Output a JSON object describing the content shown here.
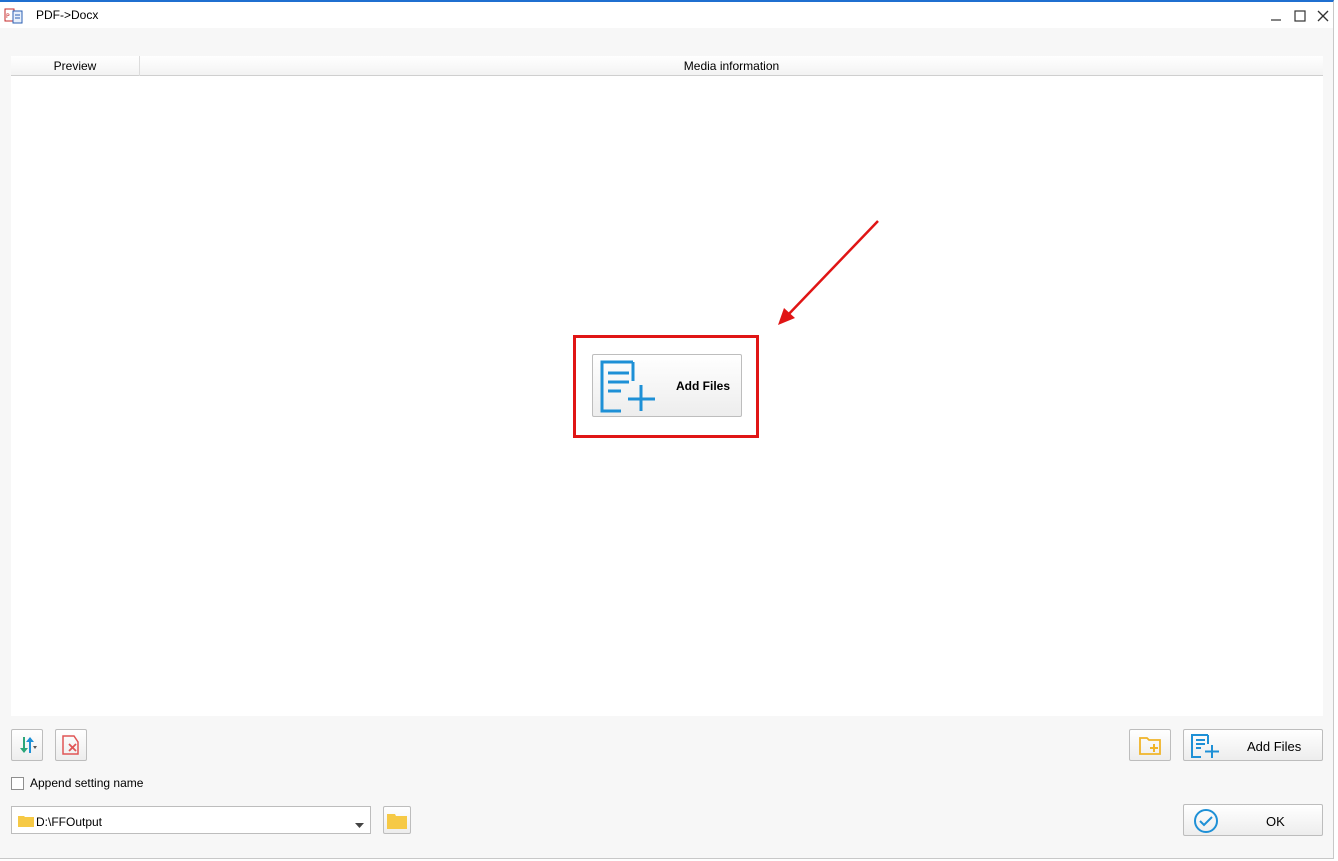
{
  "window": {
    "title": "PDF->Docx"
  },
  "list": {
    "col_preview": "Preview",
    "col_media": "Media information"
  },
  "center_button": {
    "label": "Add Files"
  },
  "bottom": {
    "append_setting_label": "Append setting name",
    "append_checked": false,
    "output_path": "D:\\FFOutput",
    "add_files_label": "Add Files",
    "ok_label": "OK"
  },
  "colors": {
    "accent_blue": "#1e90d6",
    "highlight_red": "#e01515",
    "folder_yellow": "#f6c945"
  }
}
